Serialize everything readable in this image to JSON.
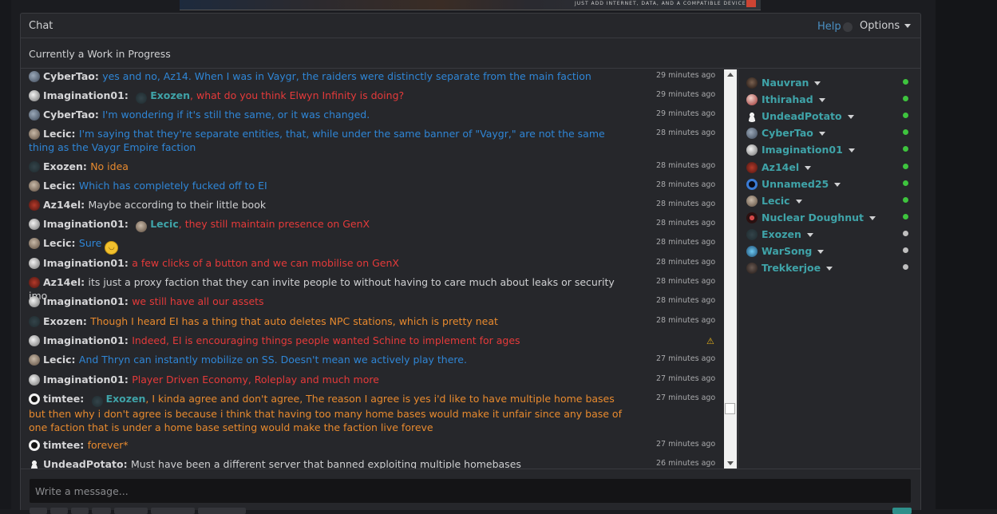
{
  "banner": {
    "text": "JUST ADD INTERNET, DATA, AND A COMPATIBLE DEVICE"
  },
  "header": {
    "title": "Chat",
    "help_label": "Help",
    "options_label": "Options"
  },
  "subtitle": "Currently a Work in Progress",
  "colors": {
    "blue_text": "#2f86d6",
    "red_text": "#e53a3a",
    "orange_text": "#e88a2e",
    "grey_text": "#cfd0d2",
    "mention": "#3fa3a8",
    "online": "#3ec43e",
    "offline": "#bfbfbf"
  },
  "messages": [
    {
      "name": "CyberTao",
      "text": "yes and no, Az14. When I was in Vaygr, the raiders were distinctly separate from the main faction",
      "time": "29 minutes ago"
    },
    {
      "name": "Imagination01",
      "mention": "Exozen",
      "text": "what do you think Elwyn Infinity is doing?",
      "time": "29 minutes ago"
    },
    {
      "name": "CyberTao",
      "text": "I'm wondering if it's still the same, or it was changed.",
      "time": "29 minutes ago"
    },
    {
      "name": "Lecic",
      "text": "I'm saying that they're separate entities, that, while under the same banner of \"Vaygr,\" are not the same thing as the Vaygr Empire faction",
      "time": "28 minutes ago"
    },
    {
      "name": "Exozen",
      "text": "No idea",
      "time": "28 minutes ago"
    },
    {
      "name": "Lecic",
      "text": "Which has completely fucked off to EI",
      "time": "28 minutes ago"
    },
    {
      "name": "Az14el",
      "text": "Maybe according to their little book",
      "time": "28 minutes ago"
    },
    {
      "name": "Imagination01",
      "mention": "Lecic",
      "text": "they still maintain presence on GenX",
      "time": "28 minutes ago"
    },
    {
      "name": "Lecic",
      "text": "Sure",
      "time": "28 minutes ago",
      "emoji": "smile"
    },
    {
      "name": "Imagination01",
      "text": "a few clicks of a button and we can mobilise on GenX",
      "time": "28 minutes ago"
    },
    {
      "name": "Az14el",
      "text": "its just a proxy faction that they can invite people to without having to care much about leaks or security imo",
      "time": "28 minutes ago"
    },
    {
      "name": "Imagination01",
      "text": "we still have all our assets",
      "time": "28 minutes ago"
    },
    {
      "name": "Exozen",
      "text": "Though I heard EI has a thing that auto deletes NPC stations, which is pretty neat",
      "time": "28 minutes ago"
    },
    {
      "name": "Imagination01",
      "text": "Indeed, EI is encouraging things people wanted Schine to implement for ages",
      "time": "",
      "warning": "warning-icon"
    },
    {
      "name": "Lecic",
      "text": "And Thryn can instantly mobilize on SS. Doesn't mean we actively play there.",
      "time": "27 minutes ago"
    },
    {
      "name": "Imagination01",
      "text": "Player Driven Economy, Roleplay and much more",
      "time": "27 minutes ago"
    },
    {
      "name": "timtee",
      "mention": "Exozen",
      "text": "I kinda agree and don't agree, The reason I agree is yes i'd like to have multiple home bases but then why i don't agree is because i think that having too many home bases would make it unfair since any base of one faction that is under a home base setting would make the faction live foreve",
      "time": "27 minutes ago"
    },
    {
      "name": "timtee",
      "text": "forever*",
      "time": "27 minutes ago"
    },
    {
      "name": "UndeadPotato",
      "text": "Must have been a different server that banned exploiting multiple homebases",
      "time": "26 minutes ago"
    }
  ],
  "users": [
    {
      "name": "Nauvran",
      "status": "online"
    },
    {
      "name": "Ithirahad",
      "status": "online"
    },
    {
      "name": "UndeadPotato",
      "status": "online"
    },
    {
      "name": "CyberTao",
      "status": "online"
    },
    {
      "name": "Imagination01",
      "status": "online"
    },
    {
      "name": "Az14el",
      "status": "online"
    },
    {
      "name": "Unnamed25",
      "status": "online"
    },
    {
      "name": "Lecic",
      "status": "online"
    },
    {
      "name": "Nuclear Doughnut",
      "status": "online"
    },
    {
      "name": "Exozen",
      "status": "offline"
    },
    {
      "name": "WarSong",
      "status": "offline"
    },
    {
      "name": "Trekkerjoe",
      "status": "offline"
    }
  ],
  "composer": {
    "placeholder": "Write a message..."
  }
}
